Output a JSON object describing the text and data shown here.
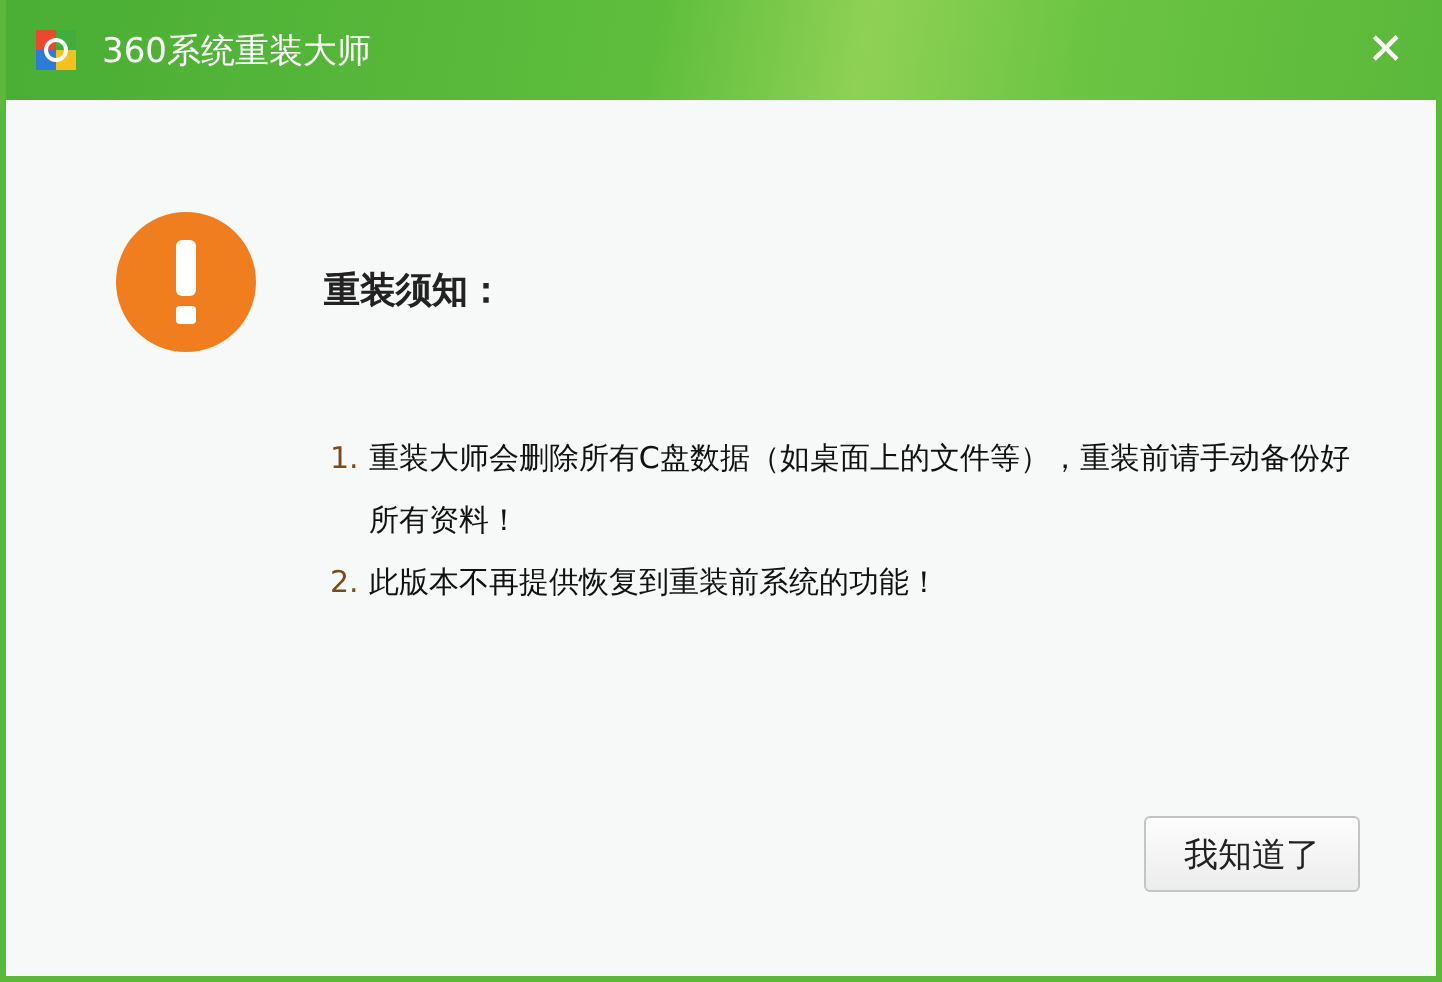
{
  "window": {
    "title": "360系统重装大师",
    "close": "✕"
  },
  "notice": {
    "heading": "重装须知：",
    "items": [
      {
        "number": "1.",
        "text": "重装大师会删除所有C盘数据（如桌面上的文件等），重装前请手动备份好所有资料！"
      },
      {
        "number": "2.",
        "text": "此版本不再提供恢复到重装前系统的功能！"
      }
    ]
  },
  "buttons": [
    {
      "label": "我知道了"
    }
  ]
}
